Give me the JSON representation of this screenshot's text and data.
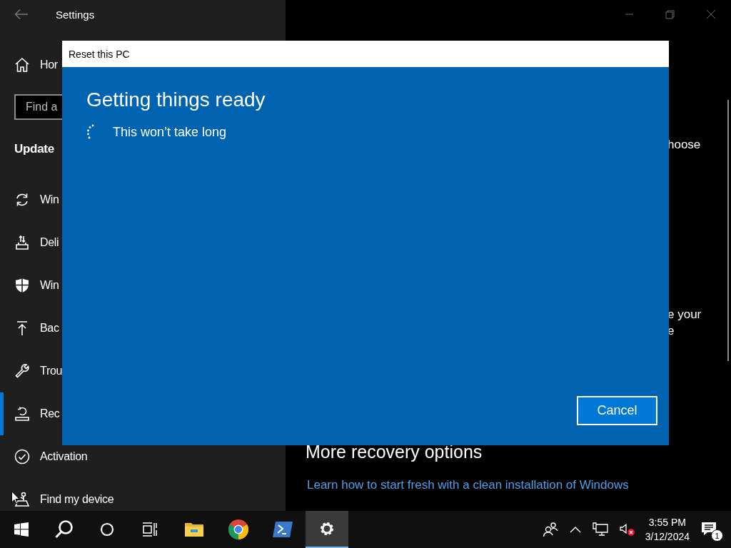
{
  "settings_window": {
    "title": "Settings",
    "sidebar": {
      "home": "Hor",
      "search": {
        "placeholder": "Find a"
      },
      "section": "Update",
      "items": [
        {
          "label": "Win",
          "selected": false
        },
        {
          "label": "Deli",
          "selected": false
        },
        {
          "label": "Win",
          "selected": false
        },
        {
          "label": "Bac",
          "selected": false
        },
        {
          "label": "Trou",
          "selected": false
        },
        {
          "label": "Rec",
          "selected": true
        },
        {
          "label": "Activation",
          "selected": false
        },
        {
          "label": "Find my device",
          "selected": false
        }
      ]
    },
    "content": {
      "fragments": [
        "hoose",
        "e your",
        "e"
      ],
      "heading": "More recovery options",
      "link": "Learn how to start fresh with a clean installation of Windows"
    }
  },
  "dialog": {
    "title": "Reset this PC",
    "heading": "Getting things ready",
    "status": "This won’t take long",
    "button": "Cancel"
  },
  "taskbar": {
    "apps": [
      {
        "kind": "start",
        "selected": false
      },
      {
        "kind": "search",
        "selected": false
      },
      {
        "kind": "cortana",
        "selected": false
      },
      {
        "kind": "taskview",
        "selected": false
      },
      {
        "kind": "explorer",
        "selected": false
      },
      {
        "kind": "browser",
        "selected": false
      },
      {
        "kind": "terminal",
        "selected": false
      },
      {
        "kind": "settings",
        "selected": true
      }
    ],
    "clock": {
      "time": "3:55 PM",
      "date": "3/12/2024"
    },
    "notifications": {
      "badge": "1"
    }
  }
}
